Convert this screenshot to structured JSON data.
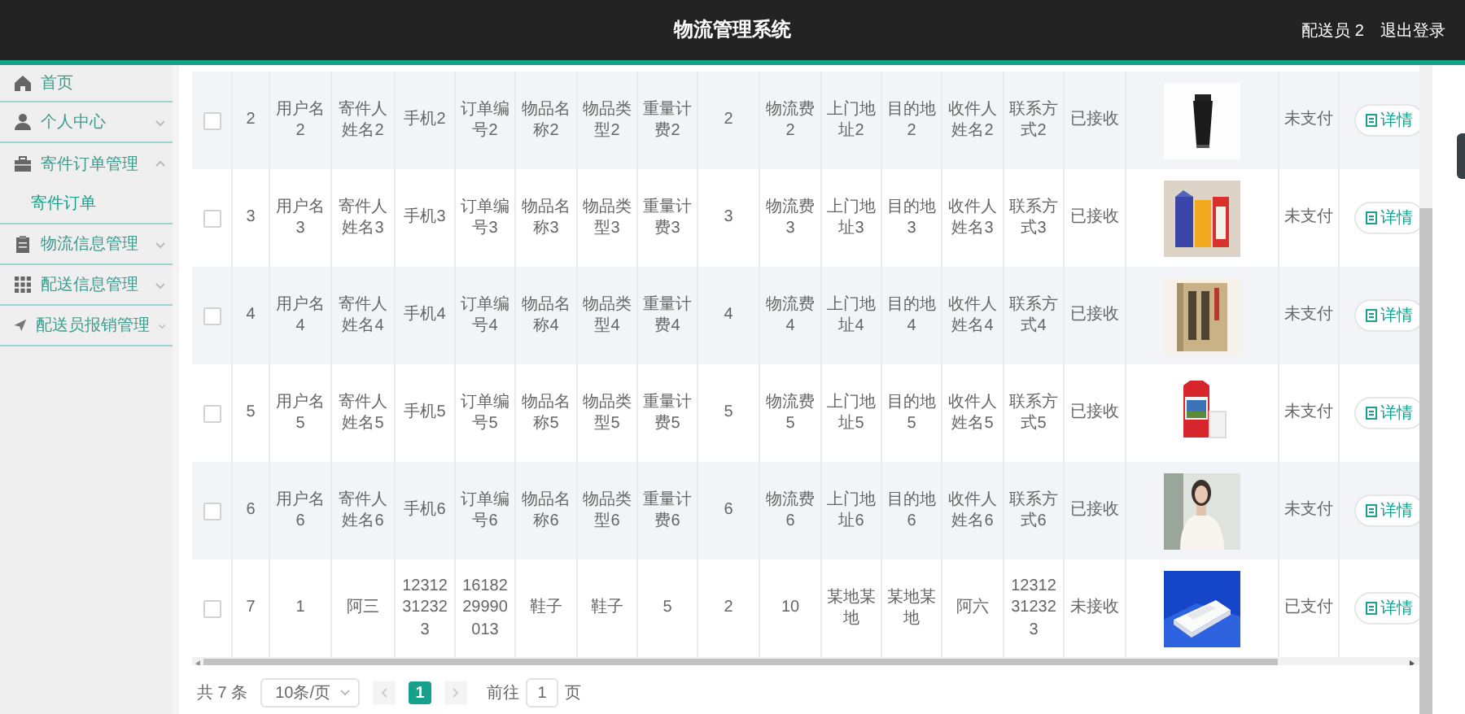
{
  "header": {
    "title": "物流管理系统",
    "user": "配送员 2",
    "logout": "退出登录"
  },
  "sidebar": {
    "items": [
      {
        "kind": "link",
        "label": "首页"
      },
      {
        "kind": "group",
        "label": "个人中心",
        "expanded": false
      },
      {
        "kind": "group",
        "label": "寄件订单管理",
        "expanded": true,
        "children": [
          {
            "label": "寄件订单",
            "selected": true
          }
        ]
      },
      {
        "kind": "group",
        "label": "物流信息管理",
        "expanded": false
      },
      {
        "kind": "group",
        "label": "配送信息管理",
        "expanded": false
      },
      {
        "kind": "group",
        "label": "配送员报销管理",
        "expanded": false
      }
    ]
  },
  "table": {
    "rows": [
      {
        "checked": false,
        "cells": [
          "2",
          "用户名2",
          "寄件人姓名2",
          "手机2",
          "订单编号2",
          "物品名称2",
          "物品类型2",
          "重量计费2",
          "2",
          "物流费2",
          "上门地址2",
          "目的地2",
          "收件人姓名2",
          "联系方式2",
          "已接收"
        ],
        "payment": "未支付",
        "action": "详情"
      },
      {
        "checked": false,
        "cells": [
          "3",
          "用户名3",
          "寄件人姓名3",
          "手机3",
          "订单编号3",
          "物品名称3",
          "物品类型3",
          "重量计费3",
          "3",
          "物流费3",
          "上门地址3",
          "目的地3",
          "收件人姓名3",
          "联系方式3",
          "已接收"
        ],
        "payment": "未支付",
        "action": "详情"
      },
      {
        "checked": false,
        "cells": [
          "4",
          "用户名4",
          "寄件人姓名4",
          "手机4",
          "订单编号4",
          "物品名称4",
          "物品类型4",
          "重量计费4",
          "4",
          "物流费4",
          "上门地址4",
          "目的地4",
          "收件人姓名4",
          "联系方式4",
          "已接收"
        ],
        "payment": "未支付",
        "action": "详情"
      },
      {
        "checked": false,
        "cells": [
          "5",
          "用户名5",
          "寄件人姓名5",
          "手机5",
          "订单编号5",
          "物品名称5",
          "物品类型5",
          "重量计费5",
          "5",
          "物流费5",
          "上门地址5",
          "目的地5",
          "收件人姓名5",
          "联系方式5",
          "已接收"
        ],
        "payment": "未支付",
        "action": "详情"
      },
      {
        "checked": false,
        "cells": [
          "6",
          "用户名6",
          "寄件人姓名6",
          "手机6",
          "订单编号6",
          "物品名称6",
          "物品类型6",
          "重量计费6",
          "6",
          "物流费6",
          "上门地址6",
          "目的地6",
          "收件人姓名6",
          "联系方式6",
          "已接收"
        ],
        "payment": "未支付",
        "action": "详情"
      },
      {
        "checked": false,
        "cells": [
          "7",
          "1",
          "阿三",
          "12312312323",
          "1618229990013",
          "鞋子",
          "鞋子",
          "5",
          "2",
          "10",
          "某地某地",
          "某地某地",
          "阿六",
          "12312312323",
          "未接收"
        ],
        "payment": "已支付",
        "action": "详情"
      }
    ]
  },
  "pagination": {
    "total": "共 7 条",
    "page_size": "10条/页",
    "pages": [
      {
        "label": "1",
        "selected": true
      }
    ],
    "goto_label": "前往",
    "goto_value": "1",
    "goto_suffix": "页"
  }
}
